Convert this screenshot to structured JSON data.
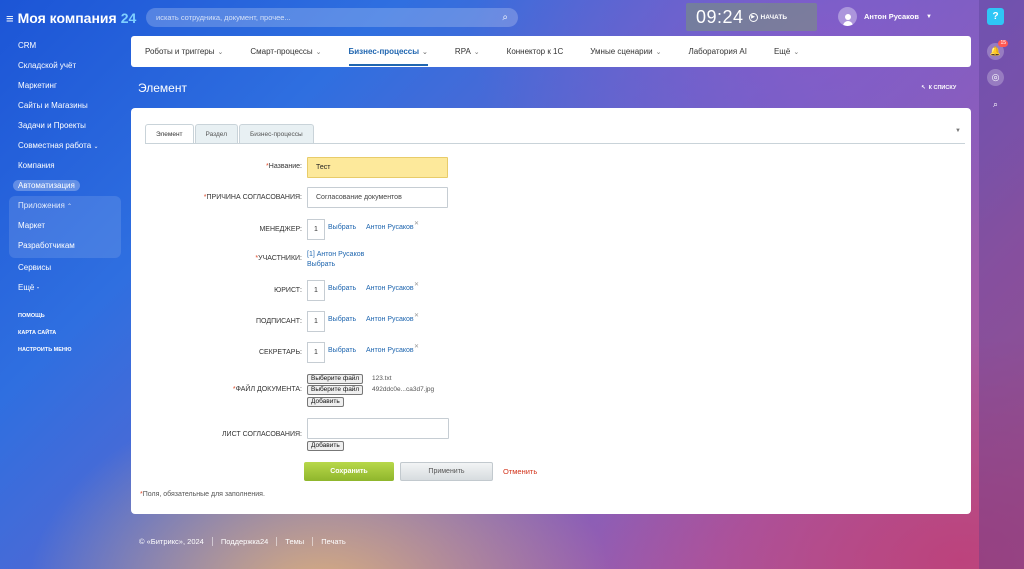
{
  "header": {
    "company": "Моя компания",
    "company_suffix": "24",
    "search_placeholder": "искать сотрудника, документ, прочее...",
    "clock_time": "09:24",
    "clock_start": "НАЧАТЬ",
    "user_name": "Антон Русаков",
    "notifications_count": "15"
  },
  "sidebar": {
    "items": [
      "CRM",
      "Складской учёт",
      "Маркетинг",
      "Сайты и Магазины",
      "Задачи и Проекты",
      "Совместная работа",
      "Компания",
      "Автоматизация"
    ],
    "group_title": "Приложения",
    "group_items": [
      "Маркет",
      "Разработчикам"
    ],
    "items_after": [
      "Сервисы",
      "Ещё"
    ],
    "small_links": [
      "ПОМОЩЬ",
      "КАРТА САЙТА",
      "НАСТРОИТЬ МЕНЮ"
    ]
  },
  "topmenu": {
    "items": [
      "Роботы и триггеры",
      "Смарт-процессы",
      "Бизнес-процессы",
      "RPA",
      "Коннектор к 1С",
      "Умные сценарии",
      "Лаборатория AI",
      "Ещё"
    ]
  },
  "page": {
    "title": "Элемент",
    "back_link": "К СПИСКУ"
  },
  "tabs": [
    "Элемент",
    "Раздел",
    "Бизнес-процессы"
  ],
  "form": {
    "name_label": "Название:",
    "name_value": "Тест",
    "reason_label": "ПРИЧИНА СОГЛАСОВАНИЯ:",
    "reason_value": "Согласование документов",
    "manager_label": "МЕНЕДЖЕР:",
    "participants_label": "УЧАСТНИКИ:",
    "participants_value": "[1] Антон Русаков",
    "lawyer_label": "ЮРИСТ:",
    "signer_label": "ПОДПИСАНТ:",
    "secretary_label": "СЕКРЕТАРЬ:",
    "file_label": "ФАЙЛ ДОКУМЕНТА:",
    "sheet_label": "ЛИСТ СОГЛАСОВАНИЯ:",
    "person_id": "1",
    "choose_link": "Выбрать",
    "person_name": "Антон Русаков",
    "choose_file": "Выберите файл",
    "file1": "123.txt",
    "file2": "492ddc0e...ca3d7.jpg",
    "add": "Добавить"
  },
  "buttons": {
    "save": "Сохранить",
    "apply": "Применить",
    "cancel": "Отменить"
  },
  "required_note": "Поля, обязательные для заполнения.",
  "footer": {
    "copyright": "© «Битрикс», 2024",
    "links": [
      "Поддержка24",
      "Темы",
      "Печать"
    ]
  }
}
